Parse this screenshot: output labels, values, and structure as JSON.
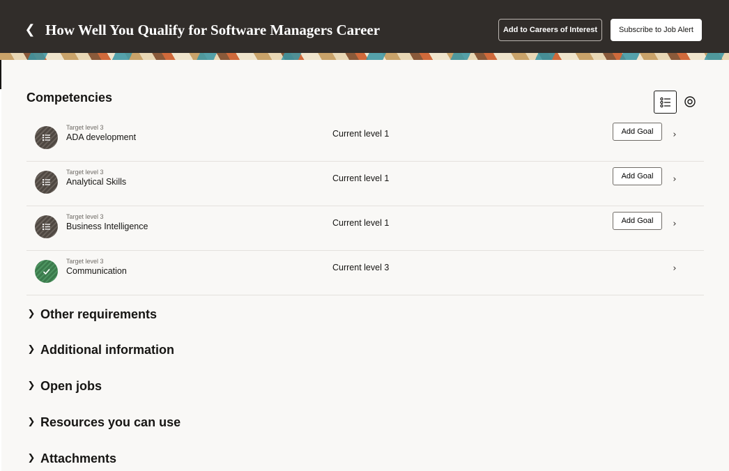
{
  "header": {
    "back_icon": "chevron-left-icon",
    "title": "How Well You Qualify for Software Managers Career",
    "add_careers_label": "Add to Careers of Interest",
    "subscribe_label": "Subscribe to Job Alert"
  },
  "competencies": {
    "title": "Competencies",
    "rows": [
      {
        "target": "Target level 3",
        "name": "ADA development",
        "current": "Current level 1",
        "goal_label": "Add Goal",
        "status": "gap",
        "icon": "checklist-icon"
      },
      {
        "target": "Target level 3",
        "name": "Analytical Skills",
        "current": "Current level 1",
        "goal_label": "Add Goal",
        "status": "gap",
        "icon": "checklist-icon"
      },
      {
        "target": "Target level 3",
        "name": "Business Intelligence",
        "current": "Current level 1",
        "goal_label": "Add Goal",
        "status": "gap",
        "icon": "checklist-icon"
      },
      {
        "target": "Target level 3",
        "name": "Communication",
        "current": "Current level 3",
        "status": "met",
        "icon": "checkmark-icon"
      }
    ]
  },
  "sections": [
    {
      "label": "Other requirements"
    },
    {
      "label": "Additional information"
    },
    {
      "label": "Open jobs"
    },
    {
      "label": "Resources you can use"
    },
    {
      "label": "Attachments"
    }
  ],
  "colors": {
    "header_bg": "#312d2a",
    "panel_bg": "#f9f8f6",
    "met_green": "#3b7a4c",
    "gap_dark": "#4f4842"
  }
}
